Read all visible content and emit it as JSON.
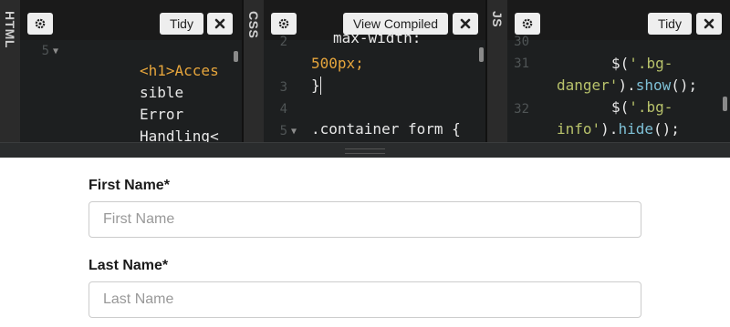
{
  "panes": {
    "html": {
      "label": "HTML",
      "settings_icon": "gear-icon",
      "tidy_label": "Tidy",
      "close_icon": "close-icon",
      "line_numbers": [
        "5"
      ],
      "code_lines": [
        "<h1>Acces",
        "sible",
        "Error",
        "Handling<"
      ]
    },
    "css": {
      "label": "CSS",
      "settings_icon": "gear-icon",
      "view_compiled_label": "View Compiled",
      "close_icon": "close-icon",
      "line_numbers": [
        "2",
        "3",
        "4",
        "5"
      ],
      "code_lines": [
        "max-width:",
        "500px;",
        "}",
        "",
        ".container form {"
      ]
    },
    "js": {
      "label": "JS",
      "settings_icon": "gear-icon",
      "tidy_label": "Tidy",
      "close_icon": "close-icon",
      "line_numbers": [
        "30",
        "31",
        "32"
      ],
      "code_lines": [
        "$('.bg-",
        "danger').show();",
        "$('.bg-",
        "info').hide();"
      ]
    }
  },
  "form": {
    "first_name": {
      "label": "First Name*",
      "placeholder": "First Name",
      "value": ""
    },
    "last_name": {
      "label": "Last Name*",
      "placeholder": "Last Name",
      "value": ""
    }
  },
  "colors": {
    "editor_bg": "#1d1f20",
    "tag": "#e6a53c",
    "string": "#b8c26b",
    "function": "#7ec0d6",
    "text": "#e8e8e8"
  }
}
